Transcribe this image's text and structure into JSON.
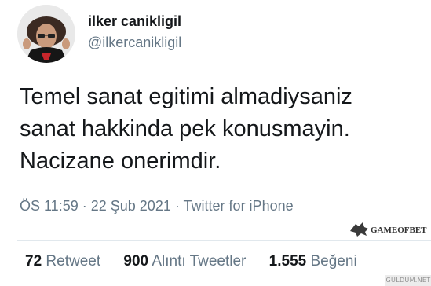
{
  "tweet": {
    "display_name": "ilker canikligil",
    "handle": "@ilkercanikligil",
    "text_lines": [
      "Temel sanat egitimi almadiysaniz",
      "sanat hakkinda pek konusmayin.",
      "Nacizane onerimdir."
    ],
    "time": "ÖS 11:59",
    "date": "22 Şub 2021",
    "separator": "·",
    "source": "Twitter for iPhone"
  },
  "stats": {
    "retweets_count": "72",
    "retweets_label": "Retweet",
    "quotes_count": "900",
    "quotes_label": "Alıntı Tweetler",
    "likes_count": "1.555",
    "likes_label": "Beğeni"
  },
  "watermarks": {
    "logo_text": "GAMEOFBET",
    "site_text": "GULDUM.NET"
  },
  "colors": {
    "primary_text": "#14171a",
    "secondary_text": "#657786",
    "divider": "#e1e8ed"
  }
}
